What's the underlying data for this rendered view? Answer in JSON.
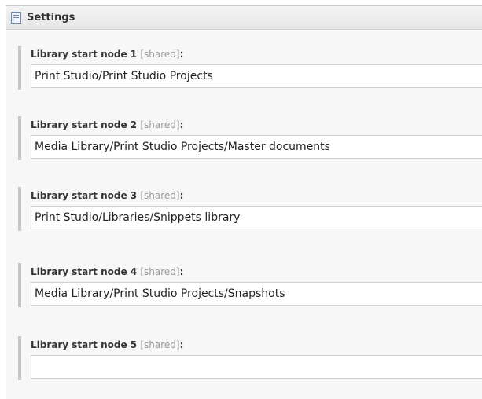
{
  "header": {
    "title": "Settings",
    "icon": "document-list-icon"
  },
  "fields": [
    {
      "label": "Library start node 1",
      "tag": "[shared]",
      "colon": ":",
      "value": "Print Studio/Print Studio Projects"
    },
    {
      "label": "Library start node 2",
      "tag": "[shared]",
      "colon": ":",
      "value": "Media Library/Print Studio Projects/Master documents"
    },
    {
      "label": "Library start node 3",
      "tag": "[shared]",
      "colon": ":",
      "value": "Print Studio/Libraries/Snippets library"
    },
    {
      "label": "Library start node 4",
      "tag": "[shared]",
      "colon": ":",
      "value": "Media Library/Print Studio Projects/Snapshots"
    },
    {
      "label": "Library start node 5",
      "tag": "[shared]",
      "colon": ":",
      "value": ""
    }
  ],
  "colors": {
    "panel_bg": "#f7f7f7",
    "header_bg": "#e6e6e6",
    "accent_bar": "#c7c7c7",
    "shared_tag": "#9a9a9a"
  }
}
